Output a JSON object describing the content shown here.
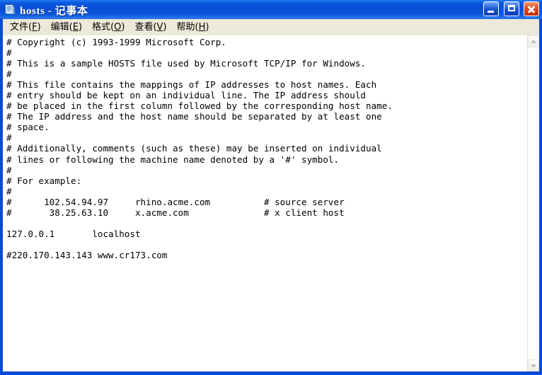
{
  "window": {
    "title": "hosts - 记事本",
    "icon": "notepad-icon",
    "colors": {
      "titlebar_blue": "#0a4ed8",
      "menubar": "#ece9d8",
      "client": "#ffffff",
      "border": "#0a4ad6",
      "close_red": "#e04a20"
    }
  },
  "caption": {
    "minimize": "Minimize",
    "maximize": "Maximize",
    "close": "Close"
  },
  "menubar": {
    "items": [
      {
        "label": "文件",
        "accel": "F"
      },
      {
        "label": "编辑",
        "accel": "E"
      },
      {
        "label": "格式",
        "accel": "O"
      },
      {
        "label": "查看",
        "accel": "V"
      },
      {
        "label": "帮助",
        "accel": "H"
      }
    ]
  },
  "editor": {
    "content": "# Copyright (c) 1993-1999 Microsoft Corp.\n#\n# This is a sample HOSTS file used by Microsoft TCP/IP for Windows.\n#\n# This file contains the mappings of IP addresses to host names. Each\n# entry should be kept on an individual line. The IP address should\n# be placed in the first column followed by the corresponding host name.\n# The IP address and the host name should be separated by at least one\n# space.\n#\n# Additionally, comments (such as these) may be inserted on individual\n# lines or following the machine name denoted by a '#' symbol.\n#\n# For example:\n#\n#      102.54.94.97     rhino.acme.com          # source server\n#       38.25.63.10     x.acme.com              # x client host\n\n127.0.0.1       localhost\n\n#220.170.143.143 www.cr173.com"
  },
  "scrollbar": {
    "up_arrow": "scroll-up-arrow",
    "down_arrow": "scroll-down-arrow"
  }
}
